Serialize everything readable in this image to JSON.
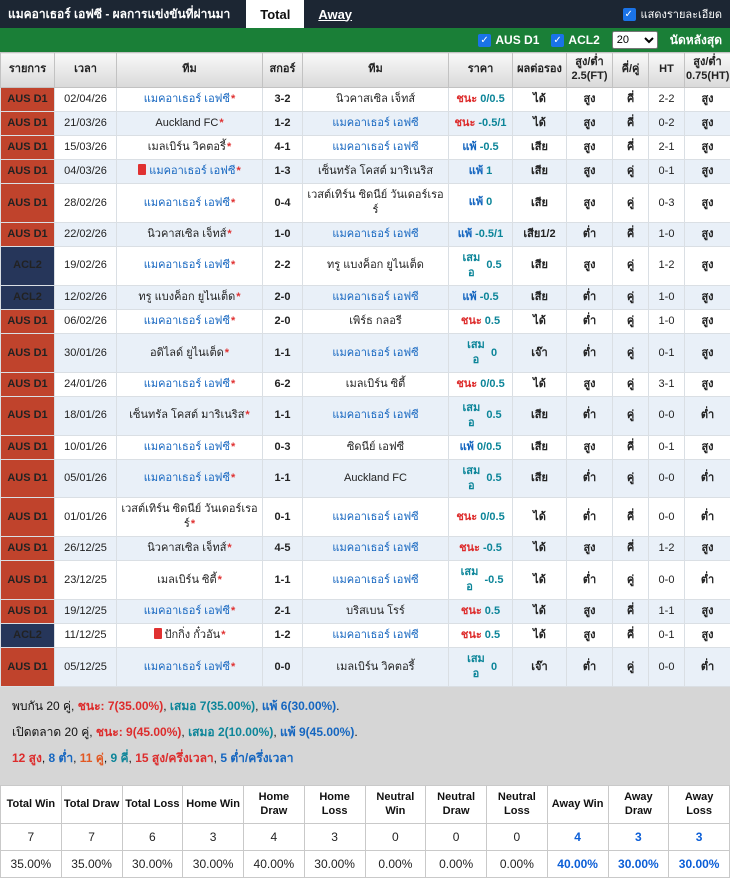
{
  "header_bar": {
    "title": "แมคอาเธอร์ เอฟซี - ผลการแข่งขันที่ผ่านมา",
    "tabs": [
      {
        "label": "Total",
        "active": true
      },
      {
        "label": "Away",
        "active": false
      }
    ],
    "show_detail_label": "แสดงรายละเอียด"
  },
  "filter_bar": {
    "leagues": [
      {
        "label": "AUS D1",
        "checked": true
      },
      {
        "label": "ACL2",
        "checked": true
      }
    ],
    "match_count": "20",
    "match_count_label": "นัดหลังสุด"
  },
  "main_team": "แมคอาเธอร์ เอฟซี",
  "home_marker": "*",
  "table": {
    "headers": [
      "รายการ",
      "เวลา",
      "ทีม",
      "สกอร์",
      "ทีม",
      "ราคา",
      "ผลต่อรอง",
      "สูง/ต่ำ\n2.5(FT)",
      "คี่/คู่",
      "HT",
      "สูง/ต่ำ\n0.75(HT)"
    ],
    "rows": [
      {
        "league": "AUS D1",
        "date": "02/04/26",
        "home": "แมคอาเธอร์ เอฟซี",
        "home_redcard": false,
        "score": "3-2",
        "away": "นิวคาสเซิล เจ็ทส์",
        "result": "ชนะ",
        "line": "0/0.5",
        "handicap": "ได้",
        "ou_ft": "สูง",
        "odd_even": "คี่",
        "ht": "2-2",
        "ou_ht": "สูง"
      },
      {
        "league": "AUS D1",
        "date": "21/03/26",
        "home": "Auckland FC",
        "home_redcard": false,
        "score": "1-2",
        "away": "แมคอาเธอร์ เอฟซี",
        "result": "ชนะ",
        "line": "-0.5/1",
        "handicap": "ได้",
        "ou_ft": "สูง",
        "odd_even": "คี่",
        "ht": "0-2",
        "ou_ht": "สูง"
      },
      {
        "league": "AUS D1",
        "date": "15/03/26",
        "home": "เมลเบิร์น วิคตอรี้",
        "home_redcard": false,
        "score": "4-1",
        "away": "แมคอาเธอร์ เอฟซี",
        "result": "แพ้",
        "line": "-0.5",
        "handicap": "เสีย",
        "ou_ft": "สูง",
        "odd_even": "คี่",
        "ht": "2-1",
        "ou_ht": "สูง"
      },
      {
        "league": "AUS D1",
        "date": "04/03/26",
        "home": "แมคอาเธอร์ เอฟซี",
        "home_redcard": true,
        "score": "1-3",
        "away": "เซ็นทรัล โคสต์ มาริเนริส",
        "result": "แพ้",
        "line": "1",
        "handicap": "เสีย",
        "ou_ft": "สูง",
        "odd_even": "คู่",
        "ht": "0-1",
        "ou_ht": "สูง"
      },
      {
        "league": "AUS D1",
        "date": "28/02/26",
        "home": "แมคอาเธอร์ เอฟซี",
        "home_redcard": false,
        "score": "0-4",
        "away": "เวสต์เทิร์น ซิดนีย์ วันเดอร์เรอร์",
        "result": "แพ้",
        "line": "0",
        "handicap": "เสีย",
        "ou_ft": "สูง",
        "odd_even": "คู่",
        "ht": "0-3",
        "ou_ht": "สูง"
      },
      {
        "league": "AUS D1",
        "date": "22/02/26",
        "home": "นิวคาสเซิล เจ็ทส์",
        "home_redcard": false,
        "score": "1-0",
        "away": "แมคอาเธอร์ เอฟซี",
        "result": "แพ้",
        "line": "-0.5/1",
        "handicap": "เสีย1/2",
        "ou_ft": "ต่ำ",
        "odd_even": "คี่",
        "ht": "1-0",
        "ou_ht": "สูง"
      },
      {
        "league": "ACL2",
        "date": "19/02/26",
        "home": "แมคอาเธอร์ เอฟซี",
        "home_redcard": false,
        "score": "2-2",
        "away": "ทรู แบงค็อก ยูไนเต็ด",
        "result": "เสมอ",
        "line": "0.5",
        "handicap": "เสีย",
        "ou_ft": "สูง",
        "odd_even": "คู่",
        "ht": "1-2",
        "ou_ht": "สูง"
      },
      {
        "league": "ACL2",
        "date": "12/02/26",
        "home": "ทรู แบงค็อก ยูไนเต็ด",
        "home_redcard": false,
        "score": "2-0",
        "away": "แมคอาเธอร์ เอฟซี",
        "result": "แพ้",
        "line": "-0.5",
        "handicap": "เสีย",
        "ou_ft": "ต่ำ",
        "odd_even": "คู่",
        "ht": "1-0",
        "ou_ht": "สูง"
      },
      {
        "league": "AUS D1",
        "date": "06/02/26",
        "home": "แมคอาเธอร์ เอฟซี",
        "home_redcard": false,
        "score": "2-0",
        "away": "เพิร์ธ กลอรี",
        "result": "ชนะ",
        "line": "0.5",
        "handicap": "ได้",
        "ou_ft": "ต่ำ",
        "odd_even": "คู่",
        "ht": "1-0",
        "ou_ht": "สูง"
      },
      {
        "league": "AUS D1",
        "date": "30/01/26",
        "home": "อดิไลด์ ยูไนเต็ด",
        "home_redcard": false,
        "score": "1-1",
        "away": "แมคอาเธอร์ เอฟซี",
        "result": "เสมอ",
        "line": "0",
        "handicap": "เจ๊า",
        "ou_ft": "ต่ำ",
        "odd_even": "คู่",
        "ht": "0-1",
        "ou_ht": "สูง"
      },
      {
        "league": "AUS D1",
        "date": "24/01/26",
        "home": "แมคอาเธอร์ เอฟซี",
        "home_redcard": false,
        "score": "6-2",
        "away": "เมลเบิร์น ซิตี้",
        "result": "ชนะ",
        "line": "0/0.5",
        "handicap": "ได้",
        "ou_ft": "สูง",
        "odd_even": "คู่",
        "ht": "3-1",
        "ou_ht": "สูง"
      },
      {
        "league": "AUS D1",
        "date": "18/01/26",
        "home": "เซ็นทรัล โคสต์ มาริเนริส",
        "home_redcard": false,
        "score": "1-1",
        "away": "แมคอาเธอร์ เอฟซี",
        "result": "เสมอ",
        "line": "0.5",
        "handicap": "เสีย",
        "ou_ft": "ต่ำ",
        "odd_even": "คู่",
        "ht": "0-0",
        "ou_ht": "ต่ำ"
      },
      {
        "league": "AUS D1",
        "date": "10/01/26",
        "home": "แมคอาเธอร์ เอฟซี",
        "home_redcard": false,
        "score": "0-3",
        "away": "ซิดนีย์ เอฟซี",
        "result": "แพ้",
        "line": "0/0.5",
        "handicap": "เสีย",
        "ou_ft": "สูง",
        "odd_even": "คี่",
        "ht": "0-1",
        "ou_ht": "สูง"
      },
      {
        "league": "AUS D1",
        "date": "05/01/26",
        "home": "แมคอาเธอร์ เอฟซี",
        "home_redcard": false,
        "score": "1-1",
        "away": "Auckland FC",
        "result": "เสมอ",
        "line": "0.5",
        "handicap": "เสีย",
        "ou_ft": "ต่ำ",
        "odd_even": "คู่",
        "ht": "0-0",
        "ou_ht": "ต่ำ"
      },
      {
        "league": "AUS D1",
        "date": "01/01/26",
        "home": "เวสต์เทิร์น ซิดนีย์ วันเดอร์เรอร์",
        "home_redcard": false,
        "score": "0-1",
        "away": "แมคอาเธอร์ เอฟซี",
        "result": "ชนะ",
        "line": "0/0.5",
        "handicap": "ได้",
        "ou_ft": "ต่ำ",
        "odd_even": "คี่",
        "ht": "0-0",
        "ou_ht": "ต่ำ"
      },
      {
        "league": "AUS D1",
        "date": "26/12/25",
        "home": "นิวคาสเซิล เจ็ทส์",
        "home_redcard": false,
        "score": "4-5",
        "away": "แมคอาเธอร์ เอฟซี",
        "result": "ชนะ",
        "line": "-0.5",
        "handicap": "ได้",
        "ou_ft": "สูง",
        "odd_even": "คี่",
        "ht": "1-2",
        "ou_ht": "สูง"
      },
      {
        "league": "AUS D1",
        "date": "23/12/25",
        "home": "เมลเบิร์น ซิตี้",
        "home_redcard": false,
        "score": "1-1",
        "away": "แมคอาเธอร์ เอฟซี",
        "result": "เสมอ",
        "line": "-0.5",
        "handicap": "ได้",
        "ou_ft": "ต่ำ",
        "odd_even": "คู่",
        "ht": "0-0",
        "ou_ht": "ต่ำ"
      },
      {
        "league": "AUS D1",
        "date": "19/12/25",
        "home": "แมคอาเธอร์ เอฟซี",
        "home_redcard": false,
        "score": "2-1",
        "away": "บริสเบน โรร์",
        "result": "ชนะ",
        "line": "0.5",
        "handicap": "ได้",
        "ou_ft": "สูง",
        "odd_even": "คี่",
        "ht": "1-1",
        "ou_ht": "สูง"
      },
      {
        "league": "ACL2",
        "date": "11/12/25",
        "home": "ปักกิ่ง กั๋วอัน",
        "home_redcard": true,
        "score": "1-2",
        "away": "แมคอาเธอร์ เอฟซี",
        "result": "ชนะ",
        "line": "0.5",
        "handicap": "ได้",
        "ou_ft": "สูง",
        "odd_even": "คี่",
        "ht": "0-1",
        "ou_ht": "สูง"
      },
      {
        "league": "AUS D1",
        "date": "05/12/25",
        "home": "แมคอาเธอร์ เอฟซี",
        "home_redcard": false,
        "score": "0-0",
        "away": "เมลเบิร์น วิคตอรี้",
        "result": "เสมอ",
        "line": "0",
        "handicap": "เจ๊า",
        "ou_ft": "ต่ำ",
        "odd_even": "คู่",
        "ht": "0-0",
        "ou_ht": "ต่ำ"
      }
    ]
  },
  "summary": {
    "line1": [
      {
        "t": "พบกัน 20 คู่, ",
        "c": "k"
      },
      {
        "t": "ชนะ: 7(35.00%)",
        "c": "r"
      },
      {
        "t": ", ",
        "c": "k"
      },
      {
        "t": "เสมอ 7(35.00%)",
        "c": "t"
      },
      {
        "t": ", ",
        "c": "k"
      },
      {
        "t": "แพ้ 6(30.00%)",
        "c": "b"
      },
      {
        "t": ".",
        "c": "k"
      }
    ],
    "line2": [
      {
        "t": "เปิดตลาด 20 คู่, ",
        "c": "k"
      },
      {
        "t": "ชนะ: 9(45.00%)",
        "c": "r"
      },
      {
        "t": ", ",
        "c": "k"
      },
      {
        "t": "เสมอ 2(10.00%)",
        "c": "t"
      },
      {
        "t": ", ",
        "c": "k"
      },
      {
        "t": "แพ้ 9(45.00%)",
        "c": "b"
      },
      {
        "t": ".",
        "c": "k"
      }
    ],
    "line3": [
      {
        "t": "12 สูง",
        "c": "r"
      },
      {
        "t": ", ",
        "c": "k"
      },
      {
        "t": "8 ต่ำ",
        "c": "b"
      },
      {
        "t": ", ",
        "c": "k"
      },
      {
        "t": "11 คู่",
        "c": "o"
      },
      {
        "t": ", ",
        "c": "k"
      },
      {
        "t": "9 คี่",
        "c": "t"
      },
      {
        "t": ", ",
        "c": "k"
      },
      {
        "t": "15 สูง/ครึ่งเวลา",
        "c": "r"
      },
      {
        "t": ", ",
        "c": "k"
      },
      {
        "t": "5 ต่ำ/ครึ่งเวลา",
        "c": "b"
      }
    ]
  },
  "stats_table": {
    "headers": [
      "Total Win",
      "Total Draw",
      "Total Loss",
      "Home Win",
      "Home Draw",
      "Home Loss",
      "Neutral Win",
      "Neutral Draw",
      "Neutral Loss",
      "Away Win",
      "Away Draw",
      "Away Loss"
    ],
    "counts": [
      "7",
      "7",
      "6",
      "3",
      "4",
      "3",
      "0",
      "0",
      "0",
      "4",
      "3",
      "3"
    ],
    "percents": [
      "35.00%",
      "35.00%",
      "30.00%",
      "30.00%",
      "40.00%",
      "30.00%",
      "0.00%",
      "0.00%",
      "0.00%",
      "40.00%",
      "30.00%",
      "30.00%"
    ],
    "away_columns_start": 9
  },
  "colors": {
    "header_bar": "#1c2633",
    "filter_bar_green": "#1a7f37",
    "aus_d1_badge": "#c0432c",
    "acl2_badge": "#26365a",
    "main_team_blue": "#1566c0",
    "win_red": "#dd2c2c",
    "lose_blue": "#1566c0",
    "draw_teal": "#0c8599",
    "odd_even_orange": "#e25822",
    "score_red": "#e03131",
    "checkbox_blue": "#1a73e8",
    "away_stat_blue": "#0b5ed7",
    "row_stripe": "#e9f0f8"
  }
}
